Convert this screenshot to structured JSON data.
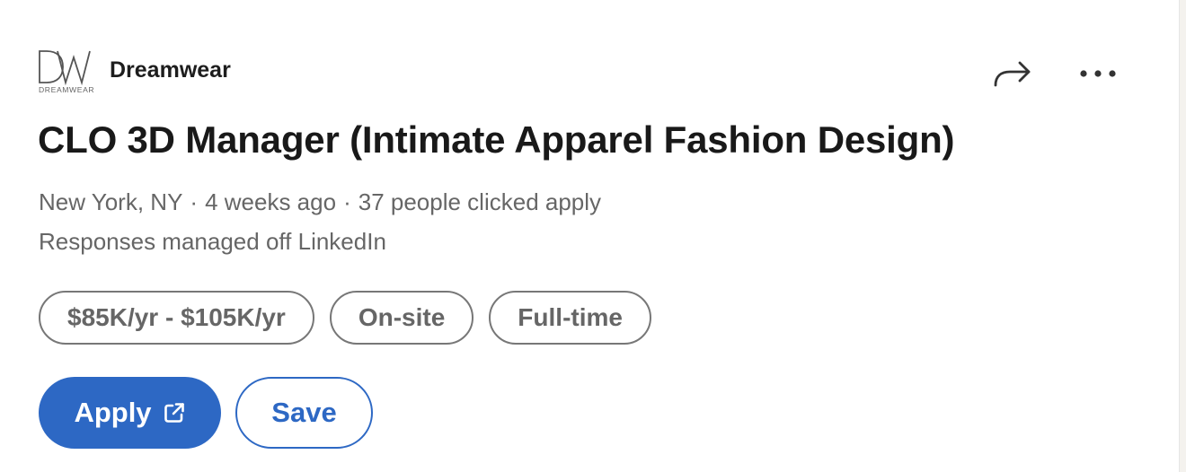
{
  "company": {
    "name": "Dreamwear",
    "logo_text": "DW",
    "logo_subtext": "DREAMWEAR"
  },
  "actions": {
    "share_icon": "share-arrow-icon",
    "more_icon": "more-horizontal-icon"
  },
  "job": {
    "title": "CLO 3D Manager (Intimate Apparel Fashion Design)",
    "location": "New York, NY",
    "posted": "4 weeks ago",
    "applicants": "37 people clicked apply",
    "separator": "·",
    "responses": "Responses managed off LinkedIn"
  },
  "pills": [
    {
      "label": "$85K/yr - $105K/yr"
    },
    {
      "label": "On-site"
    },
    {
      "label": "Full-time"
    }
  ],
  "buttons": {
    "apply_label": "Apply",
    "save_label": "Save"
  },
  "colors": {
    "primary": "#2d68c4",
    "text": "#191919",
    "muted": "#666666",
    "pill_border": "#777777"
  }
}
